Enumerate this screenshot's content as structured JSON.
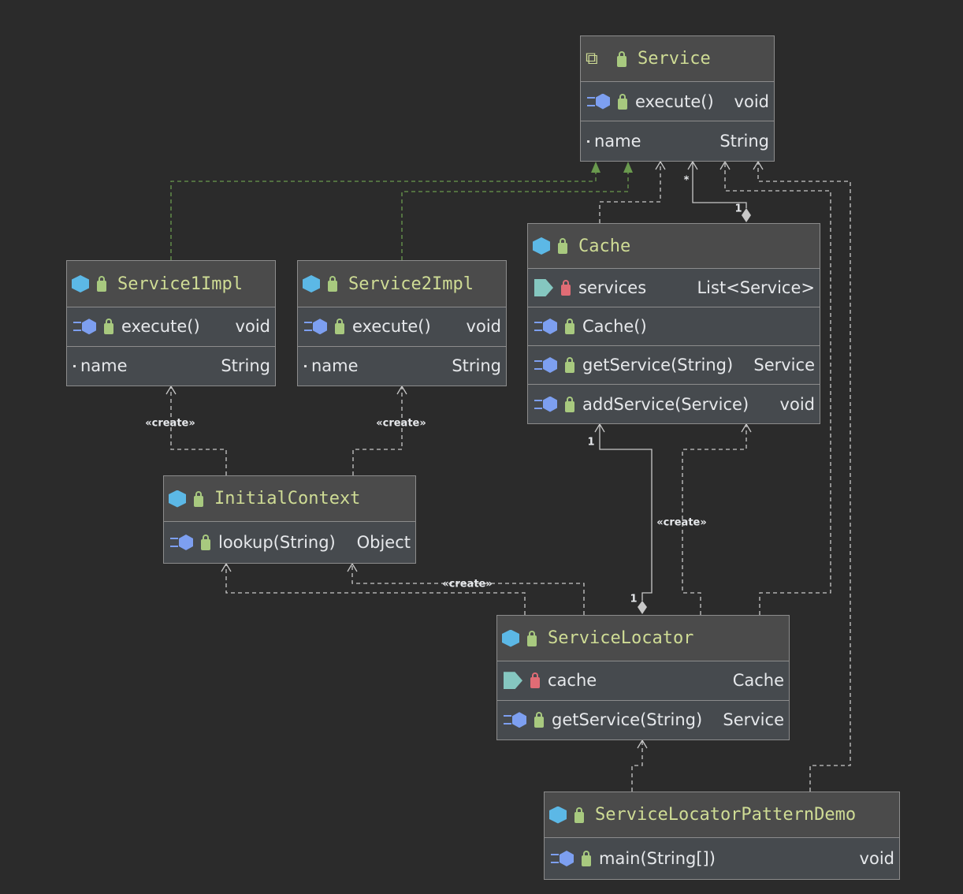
{
  "classes": [
    {
      "id": "service",
      "title": "Service",
      "kind": "interface",
      "rows": [
        {
          "icon": "method",
          "name": "execute()",
          "type": "void"
        },
        {
          "icon": "field-dot",
          "name": "name",
          "type": "String"
        }
      ]
    },
    {
      "id": "service1impl",
      "title": "Service1Impl",
      "kind": "class",
      "rows": [
        {
          "icon": "method",
          "name": "execute()",
          "type": "void"
        },
        {
          "icon": "field-dot",
          "name": "name",
          "type": "String"
        }
      ]
    },
    {
      "id": "service2impl",
      "title": "Service2Impl",
      "kind": "class",
      "rows": [
        {
          "icon": "method",
          "name": "execute()",
          "type": "void"
        },
        {
          "icon": "field-dot",
          "name": "name",
          "type": "String"
        }
      ]
    },
    {
      "id": "cache",
      "title": "Cache",
      "kind": "class",
      "rows": [
        {
          "icon": "field-private",
          "name": "services",
          "type": "List<Service>"
        },
        {
          "icon": "method",
          "name": "Cache()",
          "type": ""
        },
        {
          "icon": "method",
          "name": "getService(String)",
          "type": "Service"
        },
        {
          "icon": "method",
          "name": "addService(Service)",
          "type": "void"
        }
      ]
    },
    {
      "id": "initialcontext",
      "title": "InitialContext",
      "kind": "class",
      "rows": [
        {
          "icon": "method",
          "name": "lookup(String)",
          "type": "Object"
        }
      ]
    },
    {
      "id": "servicelocator",
      "title": "ServiceLocator",
      "kind": "class",
      "rows": [
        {
          "icon": "field-private-static",
          "name": "cache",
          "type": "Cache"
        },
        {
          "icon": "method-static",
          "name": "getService(String)",
          "type": "Service"
        }
      ]
    },
    {
      "id": "servicelocatorpatterndemo",
      "title": "ServiceLocatorPatternDemo",
      "kind": "main-class",
      "rows": [
        {
          "icon": "method-static",
          "name": "main(String[])",
          "type": "void"
        }
      ]
    }
  ],
  "edge_labels": {
    "create": "«create»",
    "one": "1",
    "many": "*"
  },
  "colors": {
    "background": "#2b2b2b",
    "title": "#cfdc95",
    "realization": "#6a9a4e",
    "edge": "#c8c8c8"
  }
}
